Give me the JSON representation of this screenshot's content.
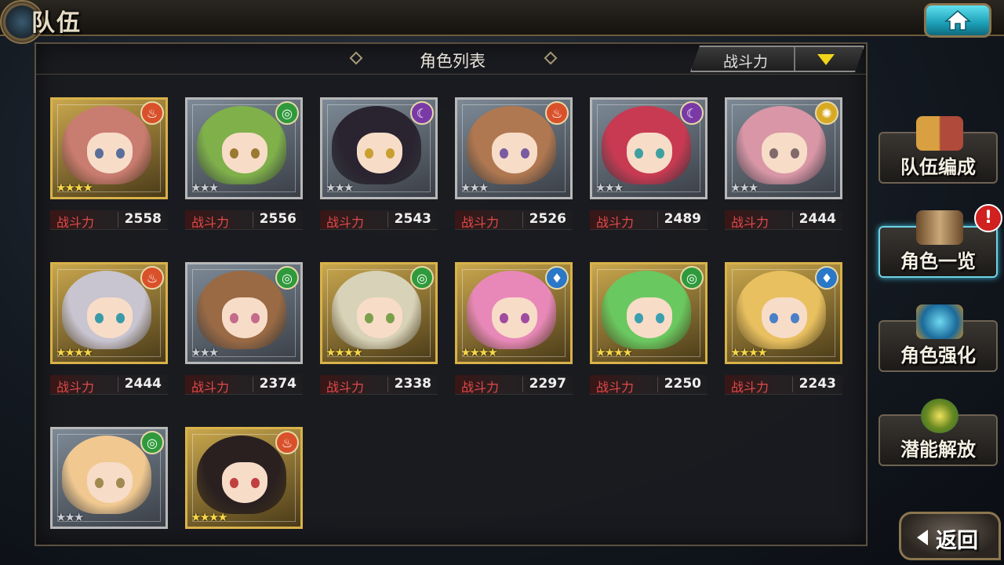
{
  "header": {
    "title": "队伍"
  },
  "panel": {
    "title": "角色列表",
    "sort_label": "战斗力"
  },
  "power_label": "战斗力",
  "characters": [
    {
      "element": "fire",
      "frame": "gold",
      "stars": 4,
      "power": "2558",
      "hair": "#c97c70",
      "eyes": "#5a6f9a"
    },
    {
      "element": "wind",
      "frame": "silver",
      "stars": 3,
      "power": "2556",
      "hair": "#7fb04a",
      "eyes": "#9a7a30"
    },
    {
      "element": "dark",
      "frame": "silver",
      "stars": 3,
      "power": "2543",
      "hair": "#2a2430",
      "eyes": "#c9a030"
    },
    {
      "element": "fire",
      "frame": "silver",
      "stars": 3,
      "power": "2526",
      "hair": "#b07850",
      "eyes": "#7a5aa0"
    },
    {
      "element": "dark",
      "frame": "silver",
      "stars": 3,
      "power": "2489",
      "hair": "#c83a52",
      "eyes": "#40a0a0"
    },
    {
      "element": "light",
      "frame": "silver",
      "stars": 3,
      "power": "2444",
      "hair": "#d896a6",
      "eyes": "#806a6a"
    },
    {
      "element": "fire",
      "frame": "gold",
      "stars": 4,
      "power": "2444",
      "hair": "#c8c4d0",
      "eyes": "#3a9aa8"
    },
    {
      "element": "wind",
      "frame": "silver",
      "stars": 3,
      "power": "2374",
      "hair": "#9a6a44",
      "eyes": "#c46a8a"
    },
    {
      "element": "wind",
      "frame": "gold",
      "stars": 4,
      "power": "2338",
      "hair": "#d8d2b8",
      "eyes": "#7aa04a"
    },
    {
      "element": "water",
      "frame": "gold",
      "stars": 4,
      "power": "2297",
      "hair": "#e888b8",
      "eyes": "#a04aa0"
    },
    {
      "element": "wind",
      "frame": "gold",
      "stars": 4,
      "power": "2250",
      "hair": "#6ac860",
      "eyes": "#3aa0b0"
    },
    {
      "element": "water",
      "frame": "gold",
      "stars": 4,
      "power": "2243",
      "hair": "#e8c060",
      "eyes": "#4a80c8"
    },
    {
      "element": "wind",
      "frame": "silver",
      "stars": 3,
      "power": "",
      "hair": "#f0c890",
      "eyes": "#a08a50"
    },
    {
      "element": "fire",
      "frame": "gold",
      "stars": 4,
      "power": "",
      "hair": "#2a2020",
      "eyes": "#c04040"
    }
  ],
  "element_colors": {
    "fire": "#d9512a",
    "wind": "#2f9a3c",
    "dark": "#7a3aa6",
    "light": "#d8a922",
    "water": "#2a78c8"
  },
  "sidebar": {
    "team_edit": "队伍编成",
    "char_list": "角色一览",
    "char_enhance": "角色强化",
    "potential": "潜能解放"
  },
  "alert_mark": "!",
  "back_label": "返回"
}
